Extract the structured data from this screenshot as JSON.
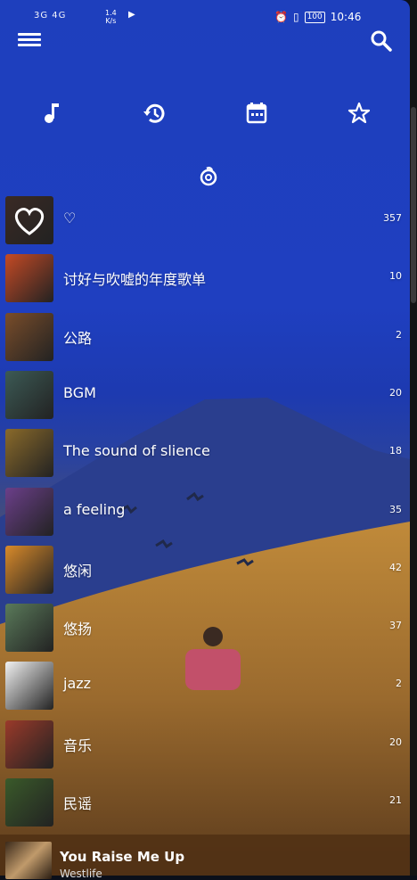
{
  "status_bar": {
    "signal_text": "3G  4G",
    "net_speed_value": "1.4",
    "net_speed_unit": "K/s",
    "battery": "100",
    "time": "10:46"
  },
  "categories": [
    {
      "name": "music-note-icon"
    },
    {
      "name": "history-icon"
    },
    {
      "name": "calendar-icon"
    },
    {
      "name": "star-icon"
    }
  ],
  "playlists": [
    {
      "title": "♡",
      "count": "357",
      "cover": "#3a2a24",
      "icon": "heart"
    },
    {
      "title": "讨好与吹嘘的年度歌单",
      "count": "10",
      "cover": "#c54a25"
    },
    {
      "title": "公路",
      "count": "2",
      "cover": "#7a4d2a"
    },
    {
      "title": "BGM",
      "count": "20",
      "cover": "#3c5a55"
    },
    {
      "title": "The sound of slience",
      "count": "18",
      "cover": "#8a6a2a"
    },
    {
      "title": "a feeling",
      "count": "35",
      "cover": "#6b3f8a"
    },
    {
      "title": "悠闲",
      "count": "42",
      "cover": "#d98a2a"
    },
    {
      "title": "悠扬",
      "count": "37",
      "cover": "#5a7a5a"
    },
    {
      "title": "jazz",
      "count": "2",
      "cover": "#f2f2f2"
    },
    {
      "title": "音乐",
      "count": "20",
      "cover": "#9a3a2a"
    },
    {
      "title": "民谣",
      "count": "21",
      "cover": "#3a5a2a"
    }
  ],
  "player": {
    "song": "You Raise Me Up",
    "artist": "Westlife"
  }
}
